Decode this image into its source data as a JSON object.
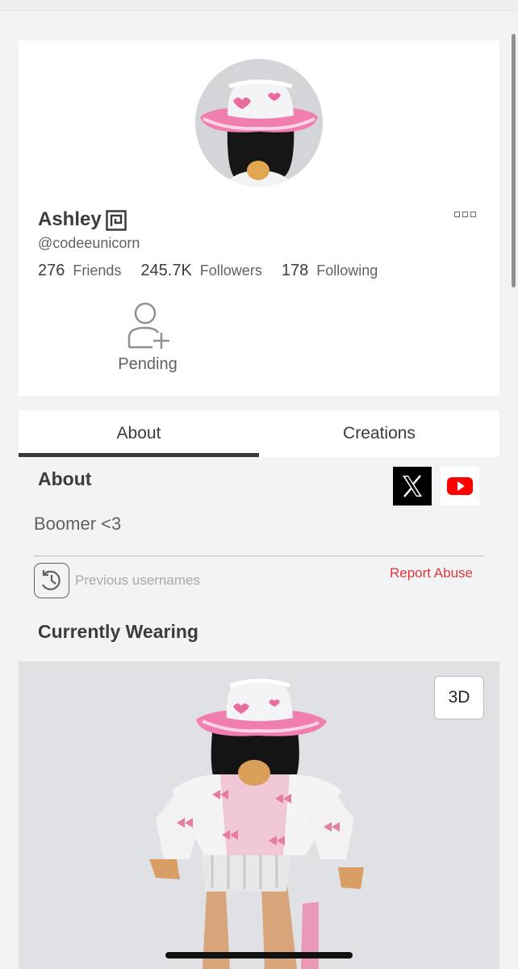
{
  "profile": {
    "display_name": "Ashley",
    "username": "@codeeunicorn",
    "stats": [
      {
        "value": "276",
        "label": "Friends"
      },
      {
        "value": "245.7K",
        "label": "Followers"
      },
      {
        "value": "178",
        "label": "Following"
      }
    ],
    "pending_label": "Pending",
    "icons": {
      "verified": "verified-badge-icon",
      "more": "more-options-icon",
      "pending": "add-friend-icon"
    }
  },
  "tabs": [
    {
      "label": "About",
      "active": true
    },
    {
      "label": "Creations",
      "active": false
    }
  ],
  "about": {
    "heading": "About",
    "bio": "Boomer <3",
    "social": [
      "x-logo-icon",
      "youtube-icon"
    ],
    "previous_usernames_label": "Previous usernames",
    "report_label": "Report Abuse"
  },
  "wearing": {
    "heading": "Currently Wearing",
    "view_3d_label": "3D"
  },
  "colors": {
    "accent_text": "#393b3d",
    "report_red": "#e0363b",
    "youtube_red": "#ff0000",
    "hat_pink": "#f07fb0"
  }
}
